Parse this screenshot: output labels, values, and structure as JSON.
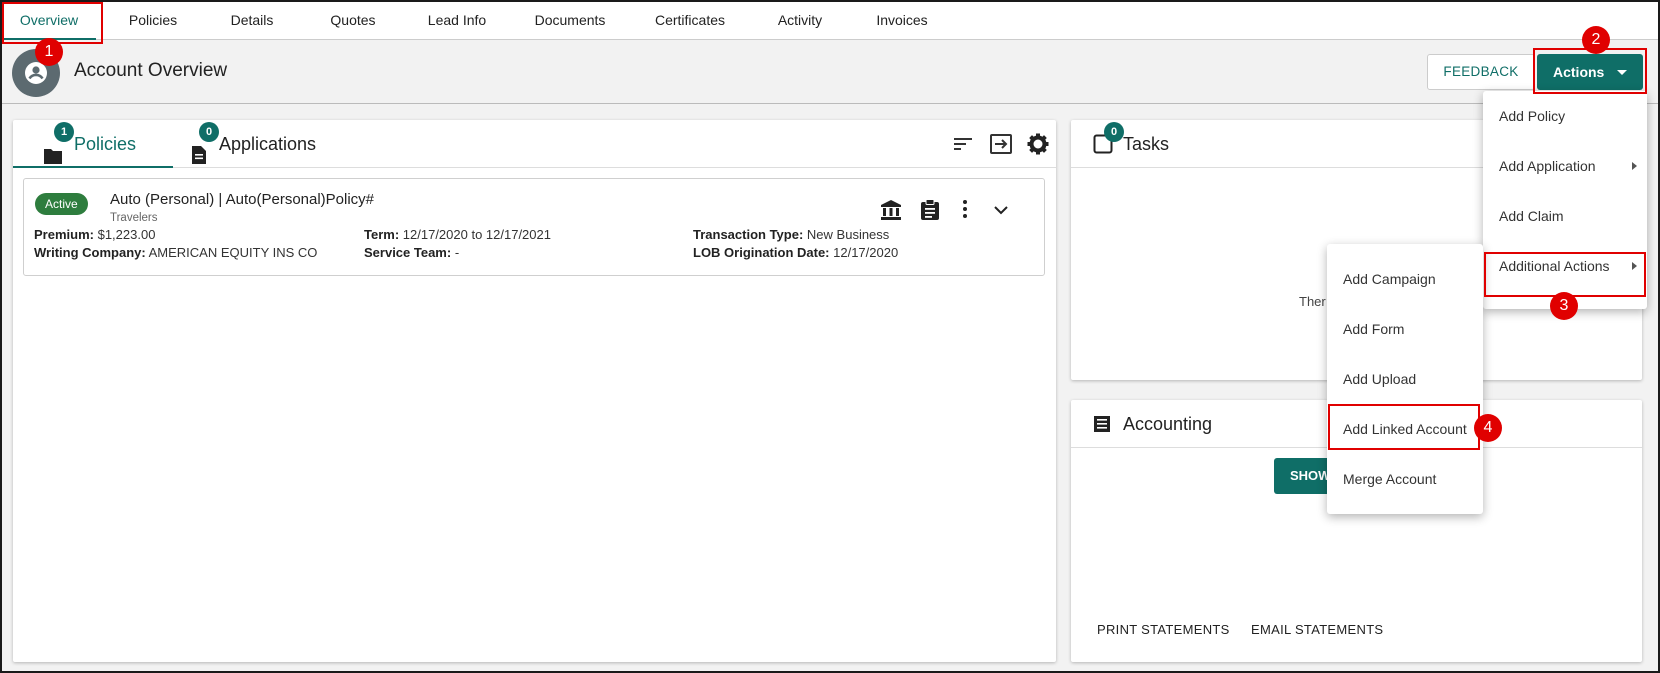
{
  "nav": {
    "tabs": [
      {
        "label": "Overview",
        "active": true
      },
      {
        "label": "Policies"
      },
      {
        "label": "Details"
      },
      {
        "label": "Quotes"
      },
      {
        "label": "Lead Info"
      },
      {
        "label": "Documents"
      },
      {
        "label": "Certificates"
      },
      {
        "label": "Activity"
      },
      {
        "label": "Invoices"
      }
    ]
  },
  "header": {
    "title": "Account Overview",
    "avatar_icon": "account-circle-icon",
    "feedback_label": "FEEDBACK",
    "actions_label": "Actions"
  },
  "policies_panel": {
    "tabs": [
      {
        "label": "Policies",
        "count": "1",
        "icon": "folder-icon",
        "active": true
      },
      {
        "label": "Applications",
        "count": "0",
        "icon": "document-icon"
      }
    ],
    "toolbar_icons": [
      "sort-icon",
      "export-icon",
      "gear-icon"
    ],
    "policy": {
      "status": "Active",
      "title": "Auto (Personal) | Auto(Personal)Policy#",
      "carrier": "Travelers",
      "premium_label": "Premium:",
      "premium": "$1,223.00",
      "writing_company_label": "Writing Company:",
      "writing_company": "AMERICAN EQUITY INS CO",
      "term_label": "Term:",
      "term": "12/17/2020 to 12/17/2021",
      "service_team_label": "Service Team:",
      "service_team": "-",
      "transaction_type_label": "Transaction Type:",
      "transaction_type": "New Business",
      "lob_date_label": "LOB Origination Date:",
      "lob_date": "12/17/2020",
      "icons": [
        "bank-icon",
        "clipboard-icon",
        "more-vert-icon",
        "chevron-down-icon"
      ]
    }
  },
  "tasks_panel": {
    "title": "Tasks",
    "count": "0",
    "empty_text": "Ther"
  },
  "accounting_panel": {
    "title": "Accounting",
    "show_button": "SHOW",
    "print_statements": "PRINT STATEMENTS",
    "email_statements": "EMAIL STATEMENTS"
  },
  "actions_menu": {
    "items": [
      {
        "label": "Add Policy"
      },
      {
        "label": "Add Application",
        "submenu": true
      },
      {
        "label": "Add Claim"
      },
      {
        "label": "Additional Actions",
        "submenu": true
      }
    ]
  },
  "additional_actions_menu": {
    "items": [
      {
        "label": "Add Campaign"
      },
      {
        "label": "Add Form"
      },
      {
        "label": "Add Upload"
      },
      {
        "label": "Add Linked Account"
      },
      {
        "label": "Merge Account"
      }
    ]
  },
  "annotations": [
    "1",
    "2",
    "3",
    "4"
  ],
  "colors": {
    "accent": "#0f6e67",
    "status_active": "#2e7d3e",
    "annotation": "#e00000"
  }
}
